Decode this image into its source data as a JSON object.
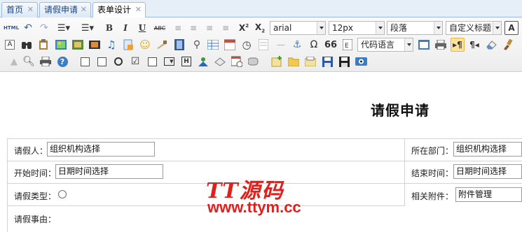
{
  "tabs": [
    {
      "label": "首页",
      "close": "✕"
    },
    {
      "label": "请假申请",
      "close": "✕"
    },
    {
      "label": "表单设计",
      "close": "✕",
      "active": true
    }
  ],
  "toolbar": {
    "html_label": "HTML",
    "font_family": "arial",
    "font_size": "12px",
    "paragraph": "段落",
    "custom_heading": "自定义标题",
    "code_language": "代码语言",
    "letter_a": "A",
    "letter_b": "B",
    "letter_i": "I",
    "letter_u": "U",
    "letter_abc": "ABC",
    "sup_x": "X",
    "sub_x": "X",
    "quote": "66",
    "omega": "Ω",
    "anchor": "⚓",
    "hline": "—",
    "text_a": "A"
  },
  "form": {
    "title": "请假申请",
    "applicant_label": "请假人：",
    "applicant_value": "组织机构选择",
    "department_label": "所在部门：",
    "department_value": "组织机构选择",
    "start_label": "开始时间：",
    "start_value": "日期时间选择",
    "end_label": "结束时间：",
    "end_value": "日期时间选择",
    "leave_type_label": "请假类型：",
    "attachment_label": "相关附件：",
    "attachment_value": "附件管理",
    "reason_label": "请假事由："
  },
  "watermark": {
    "brand": "TT源码",
    "url": "www.ttym.cc"
  },
  "colors": {
    "tab_border": "#99bbe8",
    "tab_text": "#15428b",
    "watermark": "#e0201c",
    "active_button": "#ffe39a"
  }
}
